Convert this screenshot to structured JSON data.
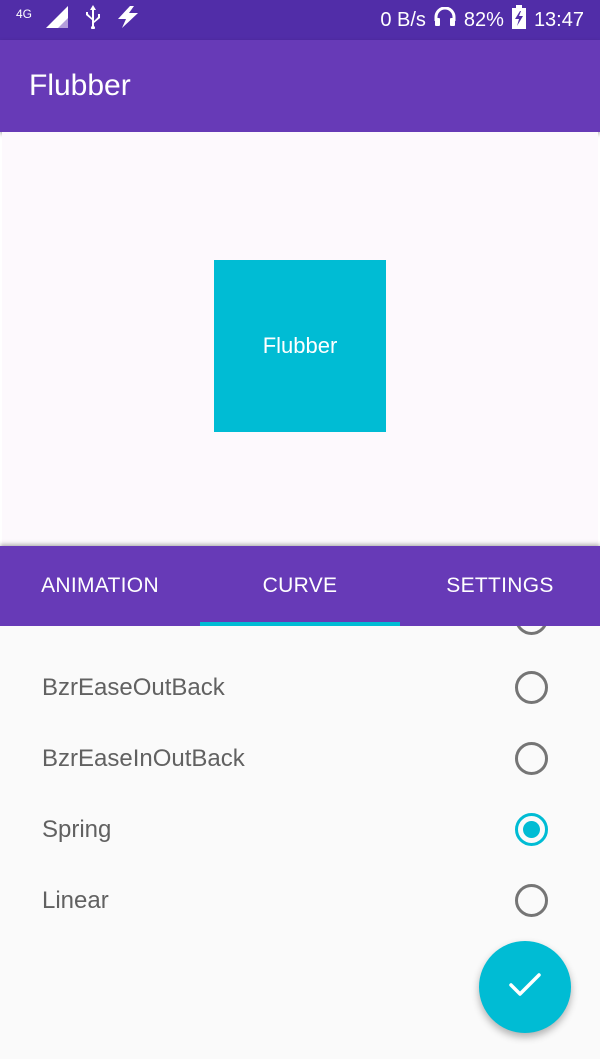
{
  "status_bar": {
    "network": "4G",
    "speed": "0 B/s",
    "battery": "82%",
    "time": "13:47",
    "icons": [
      "signal-icon",
      "usb-icon",
      "bolt-icon",
      "headset-icon",
      "battery-charging-icon"
    ]
  },
  "app_bar": {
    "title": "Flubber"
  },
  "preview": {
    "box_label": "Flubber",
    "box_color": "#00bcd4"
  },
  "tabs": [
    {
      "label": "ANIMATION",
      "active": false
    },
    {
      "label": "CURVE",
      "active": true
    },
    {
      "label": "SETTINGS",
      "active": false
    }
  ],
  "curve_list": {
    "items": [
      {
        "label": "BzrEaseOutBack",
        "selected": false
      },
      {
        "label": "BzrEaseInOutBack",
        "selected": false
      },
      {
        "label": "Spring",
        "selected": true
      },
      {
        "label": "Linear",
        "selected": false
      }
    ]
  },
  "fab": {
    "icon": "check-icon"
  },
  "colors": {
    "primary": "#673ab7",
    "primary_dark": "#512da8",
    "accent": "#00bcd4"
  }
}
